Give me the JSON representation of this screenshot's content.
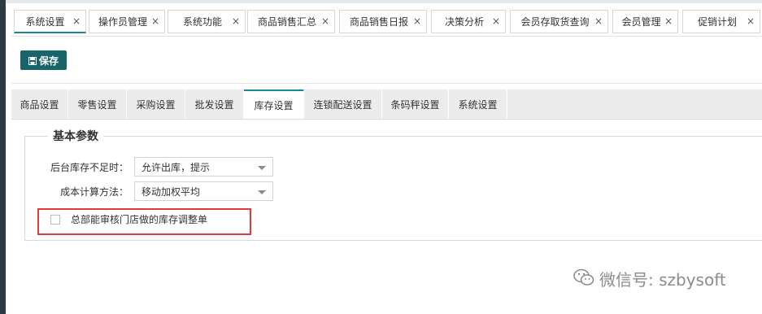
{
  "tabs": [
    {
      "label": "系统设置"
    },
    {
      "label": "操作员管理"
    },
    {
      "label": "系统功能"
    },
    {
      "label": "商品销售汇总"
    },
    {
      "label": "商品销售日报"
    },
    {
      "label": "决策分析"
    },
    {
      "label": "会员存取货查询"
    },
    {
      "label": "会员管理"
    },
    {
      "label": "促销计划"
    }
  ],
  "tab_close_glyph": "×",
  "toolbar": {
    "save_label": "保存",
    "save_icon": "save-icon"
  },
  "subtabs": [
    {
      "label": "商品设置"
    },
    {
      "label": "零售设置"
    },
    {
      "label": "采购设置"
    },
    {
      "label": "批发设置"
    },
    {
      "label": "库存设置",
      "active": true
    },
    {
      "label": "连锁配送设置"
    },
    {
      "label": "条码秤设置"
    },
    {
      "label": "系统设置"
    }
  ],
  "section": {
    "legend": "基本参数",
    "stock_shortage_label": "后台库存不足时：",
    "stock_shortage_value": "允许出库，提示",
    "cost_method_label": "成本计算方法：",
    "cost_method_value": "移动加权平均",
    "hq_audit_label": "总部能审核门店做的库存调整单",
    "hq_audit_checked": false
  },
  "watermark": {
    "text": "微信号: szbysoft",
    "icon": "wechat-icon"
  },
  "colors": {
    "accent": "#1a8a92",
    "save_button": "#17646a",
    "highlight": "#e03a3a",
    "sidebar": "#2c3a44"
  }
}
